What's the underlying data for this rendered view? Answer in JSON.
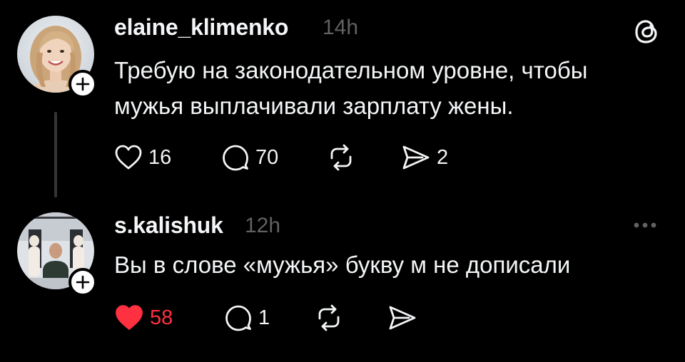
{
  "posts": [
    {
      "username": "elaine_klimenko",
      "time": "14h",
      "text_lines": [
        "Требую на законодательном уровне, чтобы",
        "мужья выплачивали зарплату жены."
      ],
      "likes": "16",
      "replies": "70",
      "shares": "2",
      "liked": false
    },
    {
      "username": "s.kalishuk",
      "time": "12h",
      "text_lines": [
        "Вы в слове «мужья» букву м не дописали"
      ],
      "likes": "58",
      "replies": "1",
      "liked": true
    }
  ],
  "icons": {
    "brand": "threads-logo-icon",
    "more": "more-options-icon",
    "like": "heart-icon",
    "reply": "comment-icon",
    "repost": "repost-icon",
    "share": "send-icon",
    "follow": "plus-icon"
  },
  "colors": {
    "background": "#000000",
    "text": "#f3f5f7",
    "muted": "#616161",
    "like_active": "#ff3040",
    "thread_line": "#333638"
  }
}
